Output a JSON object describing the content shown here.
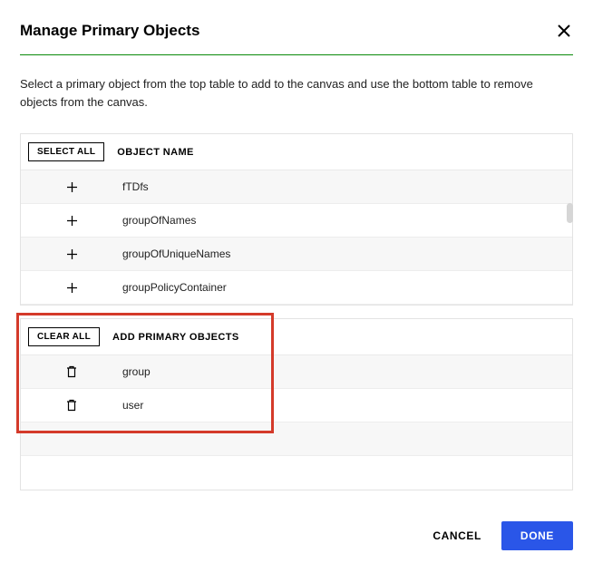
{
  "title": "Manage Primary Objects",
  "description": "Select a primary object from the top table to add to the canvas and use the bottom table to remove objects from the canvas.",
  "top_table": {
    "select_all_label": "SELECT ALL",
    "column_header": "OBJECT NAME",
    "rows": [
      {
        "name": "fTDfs"
      },
      {
        "name": "groupOfNames"
      },
      {
        "name": "groupOfUniqueNames"
      },
      {
        "name": "groupPolicyContainer"
      }
    ]
  },
  "bottom_table": {
    "clear_all_label": "CLEAR ALL",
    "column_header": "ADD PRIMARY OBJECTS",
    "rows": [
      {
        "name": "group"
      },
      {
        "name": "user"
      }
    ]
  },
  "footer": {
    "cancel_label": "CANCEL",
    "done_label": "DONE"
  }
}
